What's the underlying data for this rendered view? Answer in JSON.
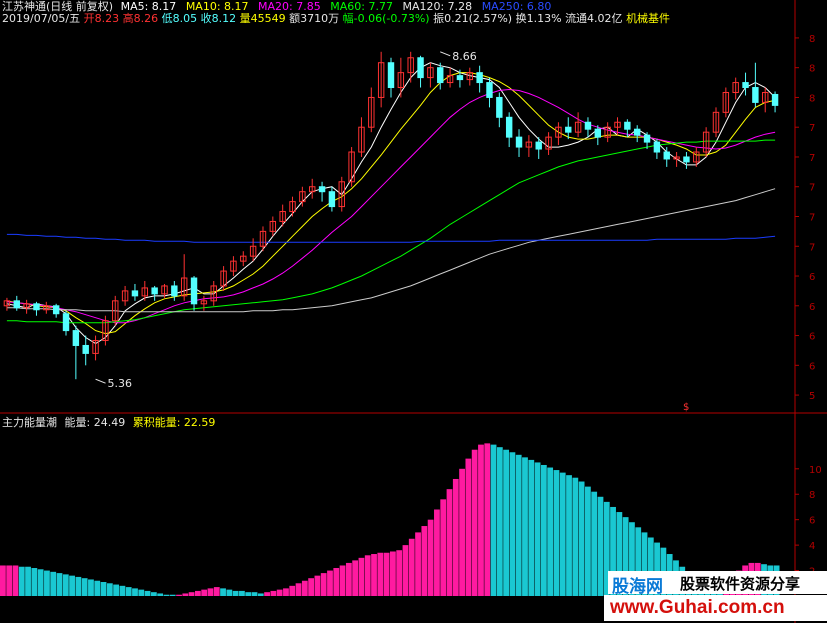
{
  "header": {
    "stock_title": "江苏神通(日线 前复权)",
    "ma5": "MA5: 8.17",
    "ma10": "MA10: 8.17",
    "ma20": "MA20: 7.85",
    "ma60": "MA60: 7.77",
    "ma120": "MA120: 7.28",
    "ma250": "MA250: 6.80",
    "date": "2019/07/05/五",
    "open_label": "开",
    "open_value": "8.23",
    "high_label": "高",
    "high_value": "8.26",
    "low_label": "低",
    "low_value": "8.05",
    "close_label": "收",
    "close_value": "8.12",
    "volume_label": "量",
    "volume_value": "45549",
    "amount": "额3710万",
    "change_label": "幅",
    "change_value": "-0.06(-0.73%)",
    "amplitude": "振0.21(2.57%)",
    "turnover": "换1.13%",
    "float_cap": "流通4.02亿",
    "industry": "机械基件"
  },
  "indicator": {
    "title": "主力能量潮",
    "energy": "能量: 24.49",
    "cumulative": "累积能量: 22.59"
  },
  "watermark": {
    "logo": "股海网",
    "slogan": "股票软件资源分享",
    "url": "www.Guhai.com.cn"
  },
  "colors": {
    "background": "#000000",
    "up_candle": "#ff3232",
    "down_candle": "#54ffff",
    "ma5": "#ffffff",
    "ma10": "#ffff00",
    "ma20": "#ff00ff",
    "ma60": "#00ff00",
    "ma120": "#cccccc",
    "ma250": "#1a3cff",
    "bar_up": "#ff1aa0",
    "bar_down": "#1ac8d2",
    "axis": "#b40000"
  },
  "chart_data": [
    {
      "type": "candlestick",
      "title": "江苏神通(日线 前复权)",
      "y_tick_labels": [
        "5",
        "6",
        "6",
        "6",
        "6",
        "7",
        "7",
        "7",
        "7",
        "7",
        "8",
        "8",
        "8"
      ],
      "annotations": [
        {
          "text": "8.66",
          "x_index": 44,
          "value": 8.66
        },
        {
          "text": "5.36",
          "x_index": 9,
          "value": 5.36
        }
      ],
      "ylim": [
        5.1,
        8.9
      ],
      "series": [
        {
          "name": "MA5",
          "values": [
            6.12,
            6.1,
            6.08,
            6.12,
            6.1,
            6.09,
            6.02,
            5.88,
            5.78,
            5.72,
            5.78,
            5.9,
            6.05,
            6.12,
            6.18,
            6.2,
            6.2,
            6.22,
            6.25,
            6.28,
            6.22,
            6.22,
            6.3,
            6.38,
            6.47,
            6.55,
            6.67,
            6.8,
            6.92,
            7.03,
            7.15,
            7.25,
            7.28,
            7.3,
            7.22,
            7.38,
            7.55,
            7.7,
            7.9,
            8.08,
            8.25,
            8.4,
            8.5,
            8.55,
            8.52,
            8.5,
            8.45,
            8.42,
            8.4,
            8.38,
            8.3,
            8.15,
            8.0,
            7.88,
            7.78,
            7.7,
            7.7,
            7.72,
            7.75,
            7.8,
            7.88,
            7.9,
            7.82,
            7.8,
            7.88,
            7.82,
            7.75,
            7.65,
            7.58,
            7.52,
            7.52,
            7.6,
            7.75,
            7.95,
            8.15,
            8.3,
            8.35,
            8.3,
            8.2
          ]
        },
        {
          "name": "MA10",
          "values": [
            6.15,
            6.13,
            6.12,
            6.1,
            6.09,
            6.08,
            6.05,
            5.98,
            5.92,
            5.85,
            5.82,
            5.84,
            5.92,
            6.0,
            6.07,
            6.13,
            6.17,
            6.19,
            6.21,
            6.22,
            6.23,
            6.24,
            6.26,
            6.3,
            6.36,
            6.42,
            6.5,
            6.6,
            6.7,
            6.8,
            6.9,
            7.0,
            7.08,
            7.15,
            7.2,
            7.28,
            7.38,
            7.5,
            7.62,
            7.75,
            7.88,
            8.0,
            8.12,
            8.25,
            8.35,
            8.42,
            8.45,
            8.45,
            8.43,
            8.4,
            8.36,
            8.3,
            8.22,
            8.12,
            8.02,
            7.92,
            7.85,
            7.8,
            7.78,
            7.78,
            7.8,
            7.82,
            7.82,
            7.8,
            7.8,
            7.8,
            7.78,
            7.75,
            7.72,
            7.68,
            7.62,
            7.62,
            7.65,
            7.72,
            7.85,
            7.98,
            8.1,
            8.15,
            8.17
          ]
        },
        {
          "name": "MA20",
          "values": [
            6.14,
            6.13,
            6.12,
            6.11,
            6.1,
            6.08,
            6.06,
            6.04,
            6.01,
            5.98,
            5.95,
            5.93,
            5.93,
            5.95,
            5.98,
            6.02,
            6.06,
            6.1,
            6.13,
            6.15,
            6.17,
            6.18,
            6.19,
            6.21,
            6.24,
            6.28,
            6.32,
            6.37,
            6.43,
            6.5,
            6.58,
            6.66,
            6.75,
            6.84,
            6.92,
            7.0,
            7.1,
            7.2,
            7.3,
            7.4,
            7.5,
            7.6,
            7.7,
            7.8,
            7.9,
            8.0,
            8.08,
            8.15,
            8.2,
            8.24,
            8.27,
            8.28,
            8.27,
            8.24,
            8.2,
            8.15,
            8.1,
            8.04,
            7.98,
            7.93,
            7.9,
            7.87,
            7.85,
            7.83,
            7.82,
            7.8,
            7.78,
            7.76,
            7.74,
            7.72,
            7.7,
            7.69,
            7.68,
            7.69,
            7.72,
            7.76,
            7.8,
            7.83,
            7.85
          ]
        },
        {
          "name": "MA60",
          "values": [
            5.95,
            5.95,
            5.94,
            5.94,
            5.94,
            5.94,
            5.93,
            5.93,
            5.93,
            5.93,
            5.93,
            5.94,
            5.95,
            5.96,
            5.98,
            6.0,
            6.02,
            6.04,
            6.06,
            6.07,
            6.08,
            6.09,
            6.1,
            6.11,
            6.12,
            6.13,
            6.14,
            6.15,
            6.16,
            6.18,
            6.2,
            6.22,
            6.25,
            6.28,
            6.32,
            6.36,
            6.4,
            6.45,
            6.5,
            6.55,
            6.6,
            6.66,
            6.72,
            6.78,
            6.85,
            6.92,
            6.98,
            7.04,
            7.1,
            7.16,
            7.22,
            7.28,
            7.34,
            7.38,
            7.42,
            7.46,
            7.5,
            7.53,
            7.56,
            7.58,
            7.6,
            7.62,
            7.64,
            7.66,
            7.68,
            7.7,
            7.72,
            7.73,
            7.74,
            7.75,
            7.75,
            7.76,
            7.76,
            7.76,
            7.76,
            7.76,
            7.76,
            7.77,
            7.77
          ]
        },
        {
          "name": "MA120",
          "values": [
            6.08,
            6.08,
            6.07,
            6.07,
            6.07,
            6.06,
            6.06,
            6.06,
            6.05,
            6.05,
            6.05,
            6.05,
            6.04,
            6.04,
            6.04,
            6.04,
            6.04,
            6.04,
            6.04,
            6.04,
            6.04,
            6.04,
            6.04,
            6.04,
            6.04,
            6.05,
            6.05,
            6.05,
            6.06,
            6.06,
            6.07,
            6.08,
            6.09,
            6.1,
            6.12,
            6.14,
            6.16,
            6.18,
            6.21,
            6.24,
            6.27,
            6.3,
            6.34,
            6.38,
            6.42,
            6.46,
            6.5,
            6.54,
            6.58,
            6.62,
            6.65,
            6.68,
            6.71,
            6.74,
            6.76,
            6.78,
            6.8,
            6.82,
            6.84,
            6.86,
            6.88,
            6.9,
            6.92,
            6.94,
            6.96,
            6.98,
            7.0,
            7.02,
            7.04,
            7.06,
            7.08,
            7.1,
            7.12,
            7.14,
            7.16,
            7.19,
            7.22,
            7.25,
            7.28
          ]
        },
        {
          "name": "MA250",
          "values": [
            6.82,
            6.82,
            6.81,
            6.81,
            6.8,
            6.8,
            6.79,
            6.79,
            6.78,
            6.78,
            6.77,
            6.77,
            6.76,
            6.76,
            6.76,
            6.75,
            6.75,
            6.75,
            6.75,
            6.74,
            6.74,
            6.74,
            6.74,
            6.74,
            6.74,
            6.74,
            6.74,
            6.74,
            6.74,
            6.74,
            6.74,
            6.74,
            6.74,
            6.74,
            6.74,
            6.74,
            6.74,
            6.74,
            6.74,
            6.74,
            6.74,
            6.74,
            6.75,
            6.75,
            6.75,
            6.75,
            6.75,
            6.75,
            6.75,
            6.75,
            6.76,
            6.76,
            6.76,
            6.76,
            6.76,
            6.76,
            6.76,
            6.76,
            6.76,
            6.76,
            6.76,
            6.76,
            6.76,
            6.76,
            6.76,
            6.76,
            6.77,
            6.77,
            6.77,
            6.77,
            6.77,
            6.77,
            6.77,
            6.77,
            6.78,
            6.78,
            6.78,
            6.79,
            6.8
          ]
        }
      ],
      "candles": [
        [
          6.1,
          6.15,
          6.05,
          6.18
        ],
        [
          6.15,
          6.08,
          6.05,
          6.2
        ],
        [
          6.08,
          6.12,
          6.02,
          6.16
        ],
        [
          6.12,
          6.06,
          6.0,
          6.14
        ],
        [
          6.06,
          6.1,
          6.02,
          6.14
        ],
        [
          6.1,
          6.02,
          5.98,
          6.12
        ],
        [
          6.02,
          5.85,
          5.8,
          6.05
        ],
        [
          5.85,
          5.7,
          5.36,
          5.9
        ],
        [
          5.7,
          5.62,
          5.5,
          5.8
        ],
        [
          5.62,
          5.75,
          5.55,
          5.8
        ],
        [
          5.75,
          5.95,
          5.7,
          6.0
        ],
        [
          5.95,
          6.15,
          5.9,
          6.2
        ],
        [
          6.15,
          6.25,
          6.1,
          6.3
        ],
        [
          6.25,
          6.2,
          6.15,
          6.32
        ],
        [
          6.2,
          6.28,
          6.15,
          6.35
        ],
        [
          6.28,
          6.22,
          6.15,
          6.3
        ],
        [
          6.22,
          6.3,
          6.18,
          6.32
        ],
        [
          6.3,
          6.2,
          6.15,
          6.35
        ],
        [
          6.2,
          6.38,
          6.15,
          6.62
        ],
        [
          6.38,
          6.12,
          6.05,
          6.4
        ],
        [
          6.12,
          6.15,
          6.05,
          6.2
        ],
        [
          6.15,
          6.3,
          6.1,
          6.35
        ],
        [
          6.3,
          6.45,
          6.25,
          6.5
        ],
        [
          6.45,
          6.55,
          6.4,
          6.6
        ],
        [
          6.55,
          6.6,
          6.5,
          6.65
        ],
        [
          6.6,
          6.7,
          6.55,
          6.78
        ],
        [
          6.7,
          6.85,
          6.65,
          6.9
        ],
        [
          6.85,
          6.95,
          6.8,
          7.0
        ],
        [
          6.95,
          7.05,
          6.9,
          7.12
        ],
        [
          7.05,
          7.15,
          7.0,
          7.2
        ],
        [
          7.15,
          7.25,
          7.1,
          7.3
        ],
        [
          7.25,
          7.3,
          7.18,
          7.38
        ],
        [
          7.3,
          7.25,
          7.15,
          7.35
        ],
        [
          7.25,
          7.1,
          7.05,
          7.3
        ],
        [
          7.1,
          7.35,
          7.05,
          7.4
        ],
        [
          7.35,
          7.65,
          7.3,
          7.7
        ],
        [
          7.65,
          7.9,
          7.6,
          8.0
        ],
        [
          7.9,
          8.2,
          7.85,
          8.3
        ],
        [
          8.2,
          8.55,
          8.1,
          8.66
        ],
        [
          8.55,
          8.3,
          8.2,
          8.6
        ],
        [
          8.3,
          8.45,
          8.2,
          8.6
        ],
        [
          8.45,
          8.6,
          8.35,
          8.66
        ],
        [
          8.6,
          8.4,
          8.3,
          8.62
        ],
        [
          8.4,
          8.5,
          8.3,
          8.55
        ],
        [
          8.5,
          8.35,
          8.28,
          8.55
        ],
        [
          8.35,
          8.42,
          8.3,
          8.5
        ],
        [
          8.42,
          8.38,
          8.3,
          8.48
        ],
        [
          8.38,
          8.45,
          8.32,
          8.5
        ],
        [
          8.45,
          8.35,
          8.25,
          8.52
        ],
        [
          8.35,
          8.2,
          8.1,
          8.4
        ],
        [
          8.2,
          8.0,
          7.9,
          8.25
        ],
        [
          8.0,
          7.8,
          7.7,
          8.05
        ],
        [
          7.8,
          7.7,
          7.6,
          7.88
        ],
        [
          7.7,
          7.75,
          7.6,
          7.82
        ],
        [
          7.75,
          7.68,
          7.58,
          7.8
        ],
        [
          7.68,
          7.8,
          7.62,
          7.85
        ],
        [
          7.8,
          7.9,
          7.72,
          7.95
        ],
        [
          7.9,
          7.85,
          7.78,
          8.0
        ],
        [
          7.85,
          7.95,
          7.8,
          8.05
        ],
        [
          7.95,
          7.88,
          7.8,
          8.0
        ],
        [
          7.88,
          7.8,
          7.72,
          7.92
        ],
        [
          7.8,
          7.9,
          7.75,
          7.95
        ],
        [
          7.9,
          7.95,
          7.82,
          8.0
        ],
        [
          7.95,
          7.88,
          7.8,
          7.98
        ],
        [
          7.88,
          7.82,
          7.75,
          7.92
        ],
        [
          7.82,
          7.75,
          7.68,
          7.85
        ],
        [
          7.75,
          7.65,
          7.58,
          7.78
        ],
        [
          7.65,
          7.58,
          7.5,
          7.7
        ],
        [
          7.58,
          7.6,
          7.5,
          7.65
        ],
        [
          7.6,
          7.55,
          7.48,
          7.65
        ],
        [
          7.55,
          7.65,
          7.5,
          7.7
        ],
        [
          7.65,
          7.85,
          7.6,
          7.9
        ],
        [
          7.85,
          8.05,
          7.8,
          8.1
        ],
        [
          8.05,
          8.25,
          8.0,
          8.3
        ],
        [
          8.25,
          8.35,
          8.18,
          8.4
        ],
        [
          8.35,
          8.3,
          8.22,
          8.45
        ],
        [
          8.3,
          8.15,
          8.1,
          8.55
        ],
        [
          8.15,
          8.25,
          8.05,
          8.3
        ],
        [
          8.23,
          8.12,
          8.05,
          8.26
        ]
      ],
      "candle_format": "[open, close, low, high]"
    },
    {
      "type": "bar",
      "title": "主力能量潮",
      "series": [
        {
          "name": "能量",
          "values": [
            24,
            24,
            24,
            23,
            23,
            22,
            21,
            20,
            19,
            18,
            17,
            16,
            15,
            14,
            13,
            12,
            11,
            10,
            9,
            8,
            7,
            6,
            5,
            4,
            3,
            2,
            1,
            1,
            1,
            2,
            3,
            4,
            5,
            6,
            7,
            6,
            5,
            4,
            4,
            3,
            3,
            2,
            3,
            4,
            5,
            6,
            8,
            10,
            12,
            14,
            16,
            18,
            20,
            22,
            24,
            26,
            28,
            30,
            32,
            33,
            34,
            34,
            35,
            36,
            40,
            45,
            50,
            55,
            60,
            68,
            76,
            84,
            92,
            100,
            108,
            115,
            119,
            120,
            119,
            117,
            115,
            113,
            111,
            109,
            107,
            105,
            103,
            101,
            99,
            97,
            95,
            93,
            90,
            86,
            82,
            78,
            74,
            70,
            66,
            62,
            58,
            54,
            50,
            46,
            42,
            38,
            33,
            28,
            23,
            18,
            14,
            12,
            12,
            11,
            10,
            12,
            16,
            20,
            24,
            26,
            26,
            25,
            24,
            24
          ]
        },
        {
          "name": "累积能量",
          "values": []
        }
      ],
      "bar_colors_pattern": "magenta when rising, cyan when falling",
      "ylim": [
        0,
        125
      ],
      "y_tick_labels": [
        "10",
        "8",
        "6",
        "4",
        "2"
      ]
    }
  ]
}
